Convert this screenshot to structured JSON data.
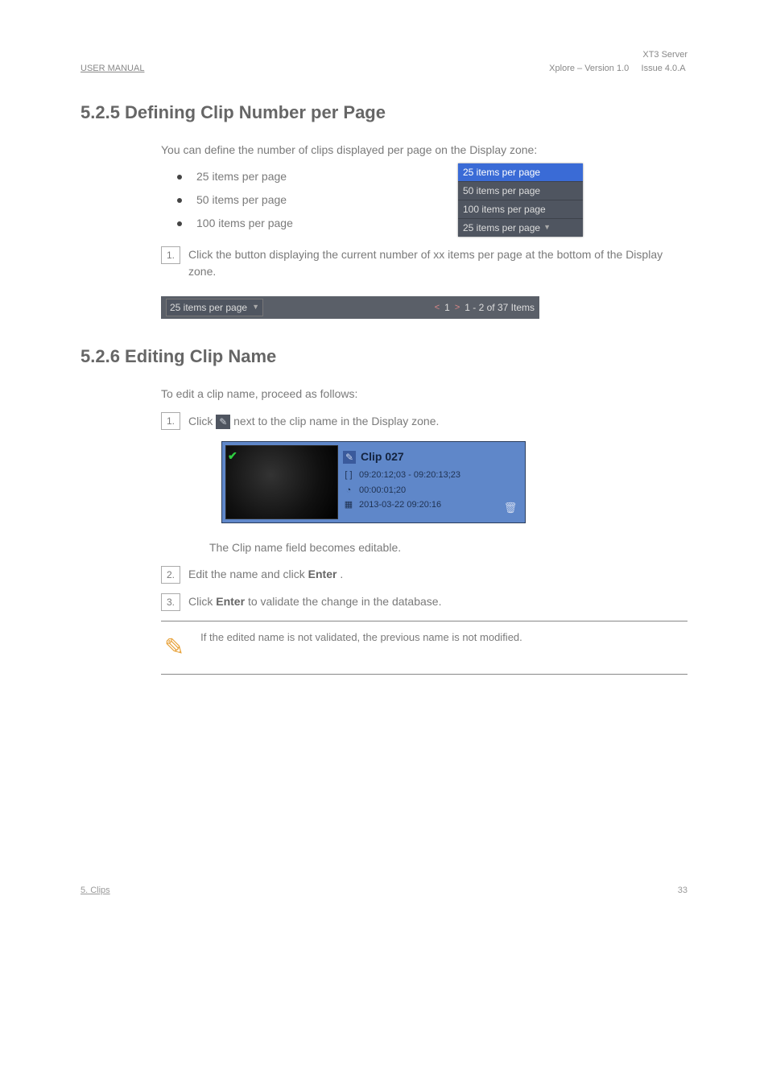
{
  "header": {
    "left": "USER MANUAL",
    "right_line1": "XT3 Server",
    "right_line2": "Xplore – Version 1.0     Issue 4.0.A "
  },
  "section525": {
    "title": "5.2.5  Defining  Clip  Number  per  Page",
    "intro": "You can define the number of clips displayed per page on the Display zone:",
    "bullets": [
      "25 items per page",
      "50 items per page",
      "100 items per page"
    ],
    "dropdown": {
      "items": [
        "25 items per page",
        "50 items per page",
        "100 items per page"
      ],
      "selected": "25 items per page",
      "footer": "25 items per page"
    },
    "step1_num": "1.",
    "step1_text": "Click the  button displaying the current number of xx items per page at the bottom of the Display zone.",
    "paginator": {
      "left": "25 items per page",
      "arrow_left": "<",
      "page": "1",
      "arrow_right": ">",
      "range": "1 - 2 of 37 Items"
    }
  },
  "section526": {
    "title": "5.2.6  Editing  Clip  Name",
    "intro": "To edit a clip name, proceed as follows:",
    "step1_num": "1.",
    "step1_text": "Click  next to the clip name in the Display zone.",
    "step1_post": " in the Display zone.",
    "step1_pre": "Click ",
    "step1_mid": " next to the clip name in the Display zone.",
    "clip": {
      "title": "Clip 027",
      "timecode": "09:20:12;03  -  09:20:13;23",
      "duration": "00:00:01;20",
      "date": "2013-03-22 09:20:16"
    },
    "post_text": "The Clip name field becomes editable.",
    "step2_num": "2.",
    "step2_text": "Edit the name and click ",
    "step2_bold": "Enter",
    "step2_after": ".",
    "step3_pre": "Click ",
    "step3_bold": "Enter",
    "step3_post": " to validate the change in the database.",
    "step3_num": "3.",
    "note": "If the edited name is not validated, the previous name is not modified."
  },
  "footer": {
    "left": "5. Clips",
    "right": "33"
  }
}
